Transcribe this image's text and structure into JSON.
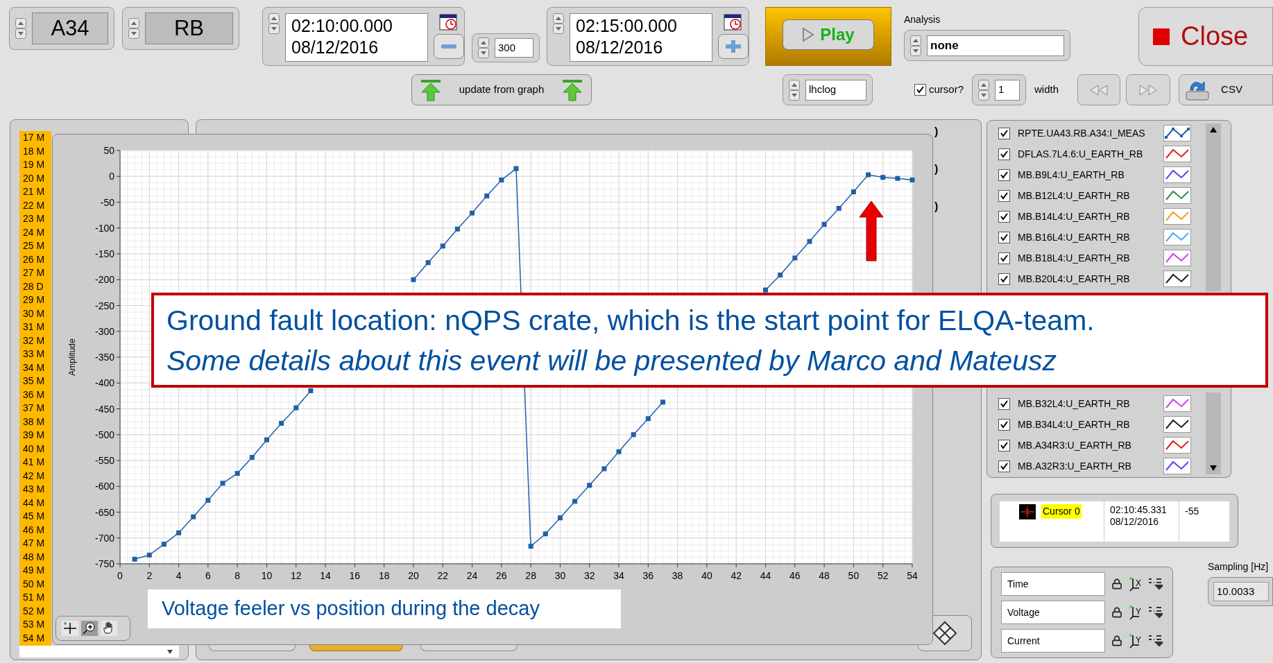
{
  "top_bar": {
    "magnet": {
      "value": "A34"
    },
    "circuit": {
      "value": "RB"
    },
    "start": {
      "value": "02:10:00.000\n08/12/2016"
    },
    "step": {
      "value": "300"
    },
    "end": {
      "value": "02:15:00.000\n08/12/2016"
    },
    "play_button": {
      "label": "Play"
    },
    "analysis": {
      "label": "Analysis",
      "value": "none"
    },
    "close_button": {
      "label": "Close"
    },
    "update_button": {
      "label": "update from graph"
    },
    "source": {
      "value": "lhclog"
    },
    "cursor_toggle": {
      "label": "cursor?",
      "checked": true
    },
    "cursor_width": {
      "value": "1",
      "label": "width"
    },
    "csv_button": {
      "label": "CSV"
    }
  },
  "position_list": {
    "items": [
      {
        "label": "17 M"
      },
      {
        "label": "18 M"
      },
      {
        "label": "19 M"
      },
      {
        "label": "20 M"
      },
      {
        "label": "21 M"
      },
      {
        "label": "22 M"
      },
      {
        "label": "23 M"
      },
      {
        "label": "24 M"
      },
      {
        "label": "25 M"
      },
      {
        "label": "26 M"
      },
      {
        "label": "27 M"
      },
      {
        "label": "28 D"
      },
      {
        "label": "29 M"
      },
      {
        "label": "30 M"
      },
      {
        "label": "31 M"
      },
      {
        "label": "32 M"
      },
      {
        "label": "33 M"
      },
      {
        "label": "34 M"
      },
      {
        "label": "35 M"
      },
      {
        "label": "36 M"
      },
      {
        "label": "37 M"
      },
      {
        "label": "38 M"
      },
      {
        "label": "39 M"
      },
      {
        "label": "40 M"
      },
      {
        "label": "41 M"
      },
      {
        "label": "42 M"
      },
      {
        "label": "43 M"
      },
      {
        "label": "44 M"
      },
      {
        "label": "45 M"
      },
      {
        "label": "46 M"
      },
      {
        "label": "47 M"
      },
      {
        "label": "48 M"
      },
      {
        "label": "49 M"
      },
      {
        "label": "50 M"
      },
      {
        "label": "51 M"
      },
      {
        "label": "52 M"
      },
      {
        "label": "53 M"
      },
      {
        "label": "54 M"
      }
    ]
  },
  "behind_panel": {
    "cut_labels": [
      ")",
      ")",
      ")"
    ]
  },
  "graph": {
    "chart_data": {
      "type": "line",
      "ylabel": "Amplitude",
      "x": [
        1,
        2,
        3,
        4,
        5,
        6,
        7,
        8,
        9,
        10,
        11,
        12,
        13,
        14,
        15,
        16,
        17,
        18,
        19,
        20,
        21,
        22,
        23,
        24,
        25,
        26,
        27,
        28,
        29,
        30,
        31,
        32,
        33,
        34,
        35,
        36,
        37,
        38,
        39,
        40,
        41,
        42,
        43,
        44,
        45,
        46,
        47,
        48,
        49,
        50,
        51,
        52,
        53,
        54
      ],
      "grid": true,
      "series": [
        {
          "color": "#1f5fa8",
          "marker": "square",
          "values": [
            -741,
            -733,
            -712,
            -690,
            -659,
            -627,
            -594,
            -575,
            -544,
            -510,
            -478,
            -448,
            -415,
            null,
            null,
            null,
            null,
            null,
            null,
            -200,
            -167,
            -135,
            -102,
            -71,
            -38,
            -7,
            15,
            -716,
            -692,
            -661,
            -629,
            -598,
            -566,
            -533,
            -500,
            -469,
            -437,
            null,
            null,
            null,
            null,
            null,
            null,
            -220,
            -191,
            -158,
            -126,
            -93,
            -62,
            -30,
            3,
            -2,
            -4,
            -7
          ]
        }
      ],
      "xlim": [
        0,
        54
      ],
      "ylim": [
        -750,
        50
      ],
      "xticks": [
        0,
        2,
        4,
        6,
        8,
        10,
        12,
        14,
        16,
        18,
        20,
        22,
        24,
        26,
        28,
        30,
        32,
        34,
        36,
        38,
        40,
        42,
        44,
        46,
        48,
        50,
        52,
        54
      ],
      "yticks": [
        50,
        0,
        -50,
        -100,
        -150,
        -200,
        -250,
        -300,
        -350,
        -400,
        -450,
        -500,
        -550,
        -600,
        -650,
        -700,
        -750
      ]
    }
  },
  "legend": {
    "groups": [
      [
        {
          "name": "RPTE.UA43.RB.A34:I_MEAS",
          "checked": true,
          "color": "#1f5fa8",
          "markers": true
        },
        {
          "name": "DFLAS.7L4.6:U_EARTH_RB",
          "checked": true,
          "color": "#e02020",
          "markers": false
        },
        {
          "name": "MB.B9L4:U_EARTH_RB",
          "checked": true,
          "color": "#6a3cf0",
          "markers": false
        },
        {
          "name": "MB.B12L4:U_EARTH_RB",
          "checked": true,
          "color": "#2e8b57",
          "markers": false
        },
        {
          "name": "MB.B14L4:U_EARTH_RB",
          "checked": true,
          "color": "#f0a020",
          "markers": false
        },
        {
          "name": "MB.B16L4:U_EARTH_RB",
          "checked": true,
          "color": "#4da6ff",
          "markers": false
        },
        {
          "name": "MB.B18L4:U_EARTH_RB",
          "checked": true,
          "color": "#d040f0",
          "markers": false
        },
        {
          "name": "MB.B20L4:U_EARTH_RB",
          "checked": true,
          "color": "#202020",
          "markers": false
        }
      ],
      [
        {
          "name": "MB.B32L4:U_EARTH_RB",
          "checked": true,
          "color": "#d040f0",
          "markers": false
        },
        {
          "name": "MB.B34L4:U_EARTH_RB",
          "checked": true,
          "color": "#202020",
          "markers": false
        },
        {
          "name": "MB.A34R3:U_EARTH_RB",
          "checked": true,
          "color": "#e02020",
          "markers": false
        },
        {
          "name": "MB.A32R3:U_EARTH_RB",
          "checked": true,
          "color": "#6a3cf0",
          "markers": false
        }
      ]
    ]
  },
  "cursor_table": {
    "rows": [
      {
        "name": "Cursor 0",
        "time": "02:10:45.331\n08/12/2016",
        "value": "-55"
      }
    ]
  },
  "axes": {
    "rows": [
      {
        "name": "Time",
        "axis": "X"
      },
      {
        "name": "Voltage",
        "axis": "Y"
      },
      {
        "name": "Current",
        "axis": "Y"
      }
    ]
  },
  "sampling": {
    "label": "Sampling [Hz]",
    "value": "10.0033"
  },
  "annotation": {
    "lines": [
      {
        "text": "Ground fault location: nQPS crate, which is the start point for ELQA-team.",
        "italic": false
      },
      {
        "text": "Some details about this event will be presented by Marco and Mateusz",
        "italic": true
      }
    ]
  },
  "caption": {
    "text": "Voltage feeler vs position during the decay"
  }
}
